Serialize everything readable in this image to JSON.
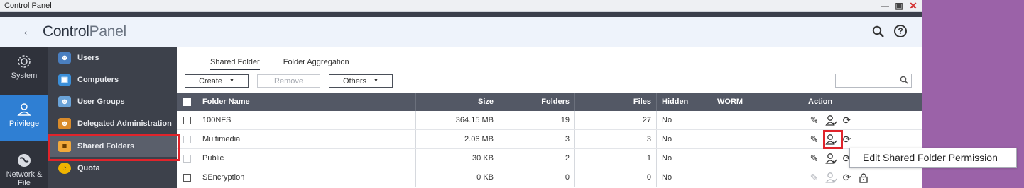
{
  "window": {
    "title": "Control Panel"
  },
  "header": {
    "app_name_bold": "Control",
    "app_name_light": "Panel"
  },
  "categories": [
    {
      "label": "System",
      "icon": "gear-icon"
    },
    {
      "label": "Privilege",
      "icon": "user-icon"
    },
    {
      "label": "Network & File",
      "icon": "network-icon"
    }
  ],
  "submenu": [
    {
      "label": "Users",
      "icon": "user-icon"
    },
    {
      "label": "Computers",
      "icon": "computer-icon"
    },
    {
      "label": "User Groups",
      "icon": "user-group-icon"
    },
    {
      "label": "Delegated Administration",
      "icon": "delegated-admin-icon"
    },
    {
      "label": "Shared Folders",
      "icon": "folder-icon"
    },
    {
      "label": "Quota",
      "icon": "quota-icon"
    }
  ],
  "tabs": [
    {
      "label": "Shared Folder"
    },
    {
      "label": "Folder Aggregation"
    }
  ],
  "toolbar": {
    "create": "Create",
    "remove": "Remove",
    "others": "Others",
    "search_placeholder": ""
  },
  "table": {
    "headers": {
      "name": "Folder Name",
      "size": "Size",
      "folders": "Folders",
      "files": "Files",
      "hidden": "Hidden",
      "worm": "WORM",
      "action": "Action"
    },
    "rows": [
      {
        "name": "100NFS",
        "size": "364.15 MB",
        "folders": "19",
        "files": "27",
        "hidden": "No",
        "worm": ""
      },
      {
        "name": "Multimedia",
        "size": "2.06 MB",
        "folders": "3",
        "files": "3",
        "hidden": "No",
        "worm": ""
      },
      {
        "name": "Public",
        "size": "30 KB",
        "folders": "2",
        "files": "1",
        "hidden": "No",
        "worm": ""
      },
      {
        "name": "SEncryption",
        "size": "0 KB",
        "folders": "0",
        "files": "0",
        "hidden": "No",
        "worm": ""
      }
    ]
  },
  "tooltip": {
    "text": "Edit Shared Folder Permission"
  }
}
